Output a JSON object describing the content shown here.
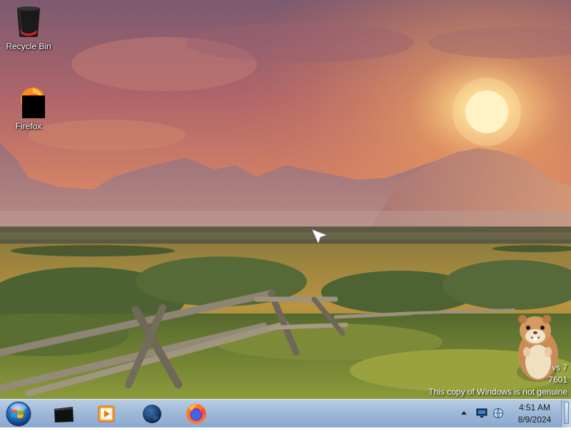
{
  "desktop": {
    "icons": [
      {
        "label": "Recycle Bin",
        "icon": "recycle-bin-icon"
      },
      {
        "label": "Firefox",
        "icon": "firefox-icon"
      }
    ],
    "watermark": {
      "line1": "vs 7",
      "line2": "7601",
      "line3": "This copy of Windows is not genuine"
    }
  },
  "taskbar": {
    "start": {
      "icon": "windows-start-orb"
    },
    "items": [
      {
        "name": "explorer-window",
        "icon": "black-window-icon"
      },
      {
        "name": "media-player",
        "icon": "media-player-icon"
      },
      {
        "name": "app-globe",
        "icon": "globe-icon"
      },
      {
        "name": "firefox",
        "icon": "firefox-icon"
      }
    ],
    "tray": {
      "icons": [
        "show-hidden-icons-arrow",
        "monitor-icon",
        "network-icon"
      ]
    },
    "clock": {
      "time": "4:51 AM",
      "date": "8/9/2024"
    }
  },
  "colors": {
    "taskbar_top": "#b9cde4",
    "taskbar_bottom": "#8ba8ce",
    "sky_top": "#7a5a6e",
    "sun": "#fff6c8"
  }
}
